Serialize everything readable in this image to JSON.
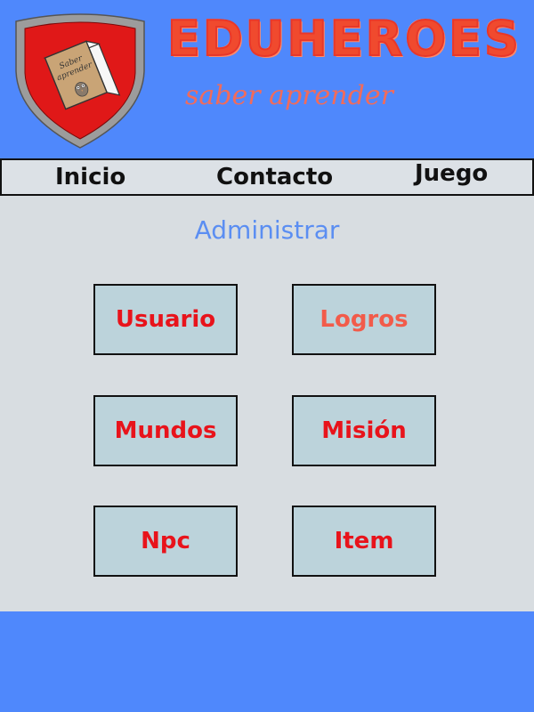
{
  "header": {
    "brand_title": "EDUHEROES",
    "tagline": "saber aprender",
    "logo": {
      "book_text_line1": "Saber",
      "book_text_line2": "aprender",
      "icon": "shield-book-logo"
    }
  },
  "nav": {
    "items": [
      {
        "label": "Inicio"
      },
      {
        "label": "Contacto"
      },
      {
        "label": "Juego"
      }
    ]
  },
  "main": {
    "title": "Administrar",
    "tiles": [
      {
        "label": "Usuario"
      },
      {
        "label": "Logros"
      },
      {
        "label": "Mundos"
      },
      {
        "label": "Misión"
      },
      {
        "label": "Npc"
      },
      {
        "label": "Item"
      }
    ]
  },
  "colors": {
    "background_blue": "#4f88fc",
    "content_gray": "#d8dde1",
    "tile_fill": "#bcd3db",
    "tile_text_red": "#e8131b",
    "brand_red": "#f04a2e",
    "shield_red": "#e01818",
    "admin_title_blue": "#5b8ef2"
  }
}
